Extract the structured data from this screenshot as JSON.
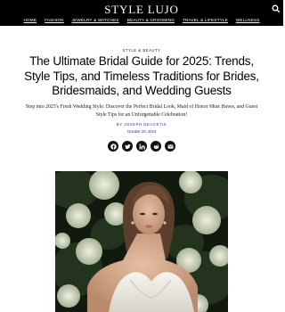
{
  "site": {
    "logo": "STYLE LUJO"
  },
  "nav": {
    "items": [
      {
        "label": "HOME"
      },
      {
        "label": "FASHION"
      },
      {
        "label": "JEWELRY & WATCHES"
      },
      {
        "label": "BEAUTY & GROOMING"
      },
      {
        "label": "TRAVEL & LIFESTYLE"
      },
      {
        "label": "WELLNESS"
      }
    ]
  },
  "article": {
    "category": "STYLE & BEAUTY",
    "title": "The Ultimate Bridal Guide for 2025: Trends, Style Tips, and Timeless Traditions for Brides, Bridesmaids, and Wedding Guests",
    "subtitle": "Step into 2025's Fresh Wedding Style: Discover the Perfect Bridal Look, Maid of Honor Must Haves, and Guest Style Tips for an Unforgettable Celebration!",
    "byline_prefix": "BY",
    "author": "JOSEPH DEACETIS",
    "date": "October 20, 2024"
  },
  "share": {
    "icons": [
      "facebook-icon",
      "twitter-icon",
      "linkedin-icon",
      "reddit-icon",
      "email-icon"
    ]
  },
  "colors": {
    "topbar": "#000000",
    "link_blue": "#1a3f7a"
  }
}
